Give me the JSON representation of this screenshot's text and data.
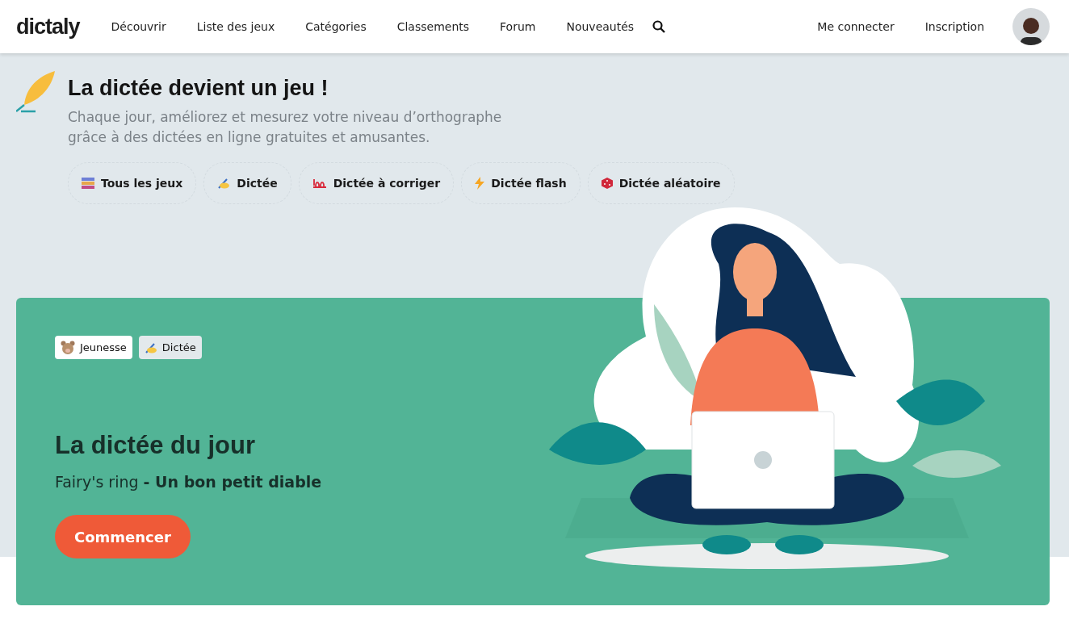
{
  "header": {
    "logo": "dictaly",
    "nav": [
      "Découvrir",
      "Liste des jeux",
      "Catégories",
      "Classements",
      "Forum",
      "Nouveautés"
    ],
    "account_links": [
      "Me connecter",
      "Inscription"
    ]
  },
  "hero": {
    "title": "La dictée devient un jeu !",
    "subtitle": "Chaque jour, améliorez et mesurez votre niveau d’orthographe grâce à des dictées en ligne gratuites et amusantes.",
    "chips": [
      {
        "kind": "books",
        "label": "Tous les jeux"
      },
      {
        "kind": "writing",
        "label": "Dictée"
      },
      {
        "kind": "hundred",
        "label": "Dictée à corriger"
      },
      {
        "kind": "flash",
        "label": "Dictée flash"
      },
      {
        "kind": "die",
        "label": "Dictée aléatoire"
      }
    ]
  },
  "featured": {
    "tags": [
      {
        "kind": "bear",
        "label": "Jeunesse",
        "color": "#ffffff"
      },
      {
        "kind": "writing",
        "label": "Dictée",
        "color": "#e3e9ec"
      }
    ],
    "title": "La dictée du jour",
    "subtitle": "Fairy's ring **- Un bon petit diable**",
    "button": "Commencer"
  }
}
